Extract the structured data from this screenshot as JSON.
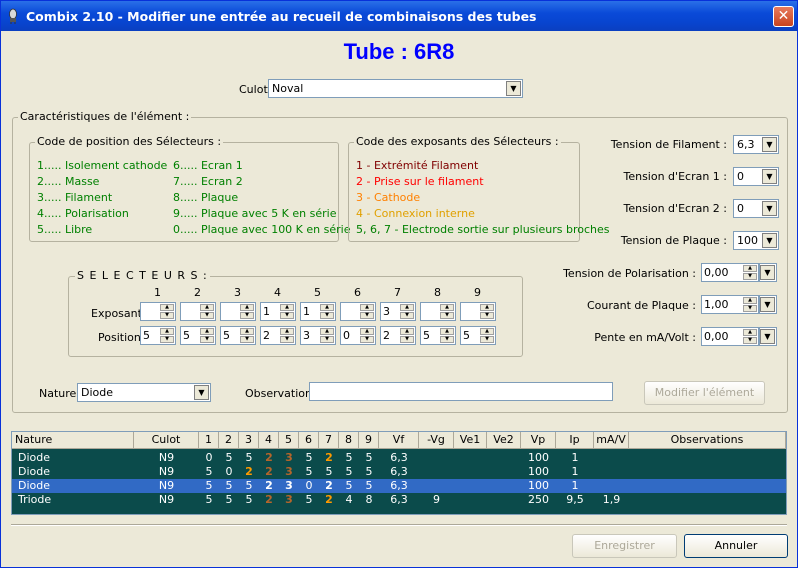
{
  "window": {
    "title": "Combix 2.10 - Modifier une entrée au recueil de combinaisons des tubes"
  },
  "heading": "Tube : 6R8",
  "culot": {
    "label": "Culot :",
    "value": "Noval"
  },
  "characteristics_legend": "Caractéristiques de l'élément :",
  "position_codes": {
    "legend": "Code de position des Sélecteurs :",
    "left": [
      "1..... Isolement cathode",
      "2..... Masse",
      "3..... Filament",
      "4..... Polarisation",
      "5..... Libre"
    ],
    "right": [
      "6..... Ecran 1",
      "7..... Ecran 2",
      "8..... Plaque",
      "9..... Plaque avec 5 K  en série",
      "0..... Plaque avec 100 K  en série"
    ]
  },
  "exponent_codes": {
    "legend": "Code des exposants des Sélecteurs :",
    "items": [
      {
        "text": "1 - Extrémité Filament",
        "color": "#800000"
      },
      {
        "text": "2 - Prise sur le filament",
        "color": "#ff0000"
      },
      {
        "text": "3 - Cathode",
        "color": "#ff8000"
      },
      {
        "text": "4 - Connexion interne",
        "color": "#e0a000"
      },
      {
        "text": "5, 6, 7 - Electrode sortie sur plusieurs broches",
        "color": "#008000"
      }
    ]
  },
  "tensions": [
    {
      "label": "Tension de Filament :",
      "value": "6,3"
    },
    {
      "label": "Tension d'Ecran 1 :",
      "value": "0"
    },
    {
      "label": "Tension d'Ecran 2 :",
      "value": "0"
    },
    {
      "label": "Tension de Plaque :",
      "value": "100"
    }
  ],
  "spins": [
    {
      "label": "Tension de Polarisation :",
      "value": "0,00"
    },
    {
      "label": "Courant de Plaque :",
      "value": "1,00"
    },
    {
      "label": "Pente en mA/Volt :",
      "value": "0,00"
    }
  ],
  "selectors": {
    "legend": "S E L E C T E U R S :",
    "numbers": [
      "1",
      "2",
      "3",
      "4",
      "5",
      "6",
      "7",
      "8",
      "9"
    ],
    "exposant_label": "Exposant :",
    "position_label": "Position :",
    "exposant": [
      "",
      "",
      "",
      "1",
      "1",
      "",
      "3",
      "",
      ""
    ],
    "position": [
      "5",
      "5",
      "5",
      "2",
      "3",
      "0",
      "2",
      "5",
      "5"
    ]
  },
  "nature": {
    "label": "Nature :",
    "value": "Diode"
  },
  "observation": {
    "label": "Observation :",
    "value": ""
  },
  "buttons": {
    "modify": "Modifier l'élément",
    "save": "Enregistrer",
    "cancel": "Annuler"
  },
  "table": {
    "columns": [
      "Nature",
      "Culot",
      "1",
      "2",
      "3",
      "4",
      "5",
      "6",
      "7",
      "8",
      "9",
      "Vf",
      "-Vg",
      "Ve1",
      "Ve2",
      "Vp",
      "Ip",
      "mA/V",
      "Observations"
    ],
    "rows": [
      {
        "cells": [
          "Diode",
          "N9",
          "0",
          "5",
          "5",
          "2",
          "3",
          "5",
          "2",
          "5",
          "5",
          "6,3",
          "",
          "",
          "",
          "100",
          "1",
          "",
          ""
        ],
        "styles": [
          "",
          "",
          "",
          "",
          "",
          "brown",
          "brown",
          "",
          "orange",
          "",
          "",
          "",
          "",
          "",
          "",
          "",
          "",
          "",
          ""
        ],
        "selected": false
      },
      {
        "cells": [
          "Diode",
          "N9",
          "5",
          "0",
          "2",
          "2",
          "3",
          "5",
          "5",
          "5",
          "5",
          "6,3",
          "",
          "",
          "",
          "100",
          "1",
          "",
          ""
        ],
        "styles": [
          "",
          "",
          "",
          "",
          "orange",
          "brown",
          "brown",
          "",
          "",
          "",
          "",
          "",
          "",
          "",
          "",
          "",
          "",
          "",
          ""
        ],
        "selected": false
      },
      {
        "cells": [
          "Diode",
          "N9",
          "5",
          "5",
          "5",
          "2",
          "3",
          "0",
          "2",
          "5",
          "5",
          "6,3",
          "",
          "",
          "",
          "100",
          "1",
          "",
          ""
        ],
        "styles": [
          "",
          "",
          "",
          "",
          "",
          "white-b",
          "white-b",
          "",
          "white-b",
          "",
          "",
          "",
          "",
          "",
          "",
          "",
          "",
          "",
          ""
        ],
        "selected": true
      },
      {
        "cells": [
          "Triode",
          "N9",
          "5",
          "5",
          "5",
          "2",
          "3",
          "5",
          "2",
          "4",
          "8",
          "6,3",
          "9",
          "",
          "",
          "250",
          "9,5",
          "1,9",
          ""
        ],
        "styles": [
          "",
          "",
          "",
          "",
          "",
          "brown",
          "brown",
          "",
          "orange",
          "",
          "",
          "",
          "",
          "",
          "",
          "",
          "",
          "",
          ""
        ],
        "selected": false
      }
    ]
  }
}
